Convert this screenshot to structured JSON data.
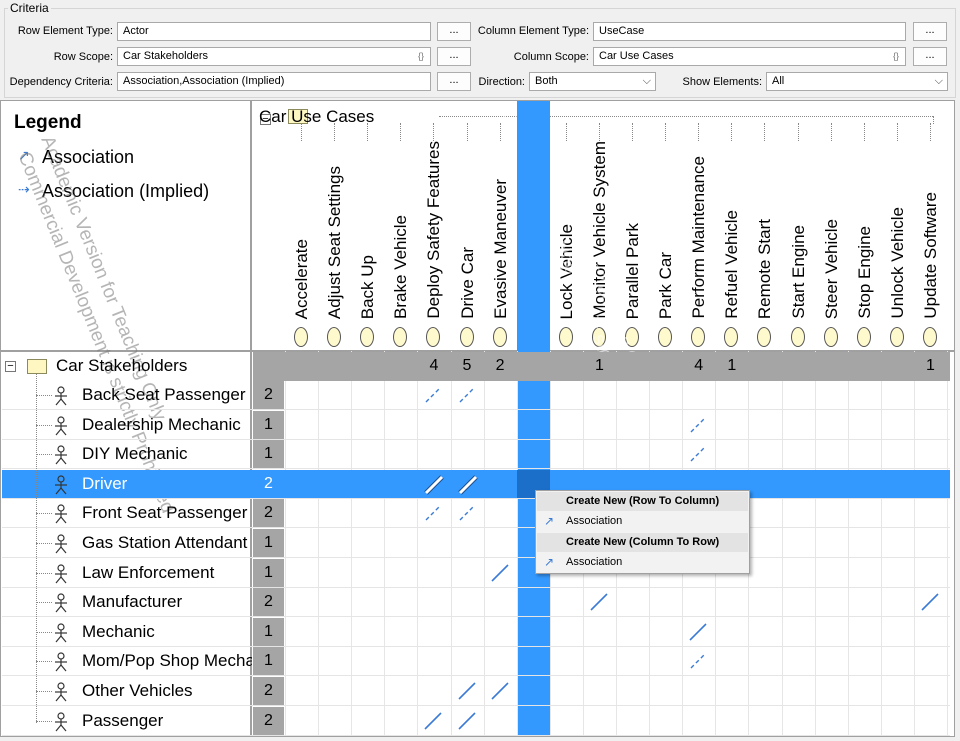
{
  "criteria": {
    "title": "Criteria",
    "row_element_type": {
      "label": "Row Element Type:",
      "value": "Actor"
    },
    "column_element_type": {
      "label": "Column Element Type:",
      "value": "UseCase"
    },
    "row_scope": {
      "label": "Row Scope:",
      "value": "Car Stakeholders"
    },
    "column_scope": {
      "label": "Column Scope:",
      "value": "Car Use Cases"
    },
    "dependency_criteria": {
      "label": "Dependency Criteria:",
      "value": "Association,Association (Implied)"
    },
    "direction": {
      "label": "Direction:",
      "value": "Both"
    },
    "show_elements": {
      "label": "Show Elements:",
      "value": "All"
    },
    "ellipsis": "...",
    "regex_glyph": "{}"
  },
  "legend": {
    "title": "Legend",
    "items": [
      {
        "label": "Association",
        "icon": "association-arrow-icon"
      },
      {
        "label": "Association (Implied)",
        "icon": "implied-association-arrow-icon"
      }
    ]
  },
  "columns_group": "Car Use Cases",
  "columns": [
    "Accelerate",
    "Adjust Seat Settings",
    "Back Up",
    "Brake Vehicle",
    "Deploy Safety Features",
    "Drive Car",
    "Evasive Maneuver",
    "",
    "Lock Vehicle",
    "Monitor Vehicle System",
    "Parallel Park",
    "Park Car",
    "Perform Maintenance",
    "Refuel Vehicle",
    "Remote Start",
    "Start Engine",
    "Steer Vehicle",
    "Stop Engine",
    "Unlock Vehicle",
    "Update Software"
  ],
  "rows_group": {
    "label": "Car Stakeholders",
    "summary": [
      "",
      "",
      "",
      "",
      "4",
      "5",
      "2",
      "",
      "",
      "1",
      "",
      "",
      "4",
      "1",
      "",
      "",
      "",
      "",
      "",
      "1"
    ]
  },
  "rows": [
    {
      "label": "Back Seat Passenger",
      "count": "2"
    },
    {
      "label": "Dealership Mechanic",
      "count": "1"
    },
    {
      "label": "DIY Mechanic",
      "count": "1"
    },
    {
      "label": "Driver",
      "count": "2"
    },
    {
      "label": "Front Seat Passenger",
      "count": "2"
    },
    {
      "label": "Gas Station Attendant",
      "count": "1"
    },
    {
      "label": "Law Enforcement",
      "count": "1"
    },
    {
      "label": "Manufacturer",
      "count": "2"
    },
    {
      "label": "Mechanic",
      "count": "1"
    },
    {
      "label": "Mom/Pop Shop Mechanic",
      "count": "1"
    },
    {
      "label": "Other Vehicles",
      "count": "2"
    },
    {
      "label": "Passenger",
      "count": "2"
    }
  ],
  "cells": [
    {
      "row": 0,
      "col": 4,
      "kind": "implied"
    },
    {
      "row": 0,
      "col": 5,
      "kind": "implied"
    },
    {
      "row": 1,
      "col": 12,
      "kind": "implied"
    },
    {
      "row": 2,
      "col": 12,
      "kind": "implied"
    },
    {
      "row": 3,
      "col": 4,
      "kind": "direct-selected"
    },
    {
      "row": 3,
      "col": 5,
      "kind": "direct-selected"
    },
    {
      "row": 4,
      "col": 4,
      "kind": "implied"
    },
    {
      "row": 4,
      "col": 5,
      "kind": "implied"
    },
    {
      "row": 6,
      "col": 6,
      "kind": "direct"
    },
    {
      "row": 7,
      "col": 9,
      "kind": "direct"
    },
    {
      "row": 7,
      "col": 19,
      "kind": "direct"
    },
    {
      "row": 8,
      "col": 12,
      "kind": "direct"
    },
    {
      "row": 9,
      "col": 12,
      "kind": "implied"
    },
    {
      "row": 10,
      "col": 5,
      "kind": "direct"
    },
    {
      "row": 10,
      "col": 6,
      "kind": "direct"
    },
    {
      "row": 11,
      "col": 4,
      "kind": "direct"
    },
    {
      "row": 11,
      "col": 5,
      "kind": "direct"
    }
  ],
  "selection": {
    "row": 3,
    "col": 7
  },
  "context_menu": {
    "header1": "Create New (Row To Column)",
    "item1": "Association",
    "header2": "Create New (Column To Row)",
    "item2": "Association"
  },
  "watermarks": [
    "Academic Version for Teaching Only",
    "Commercial Development is strictly Prohibited"
  ],
  "colors": {
    "selection": "#3399ff",
    "accent": "#3a7bd5",
    "count_bg": "#a5a5a5"
  }
}
